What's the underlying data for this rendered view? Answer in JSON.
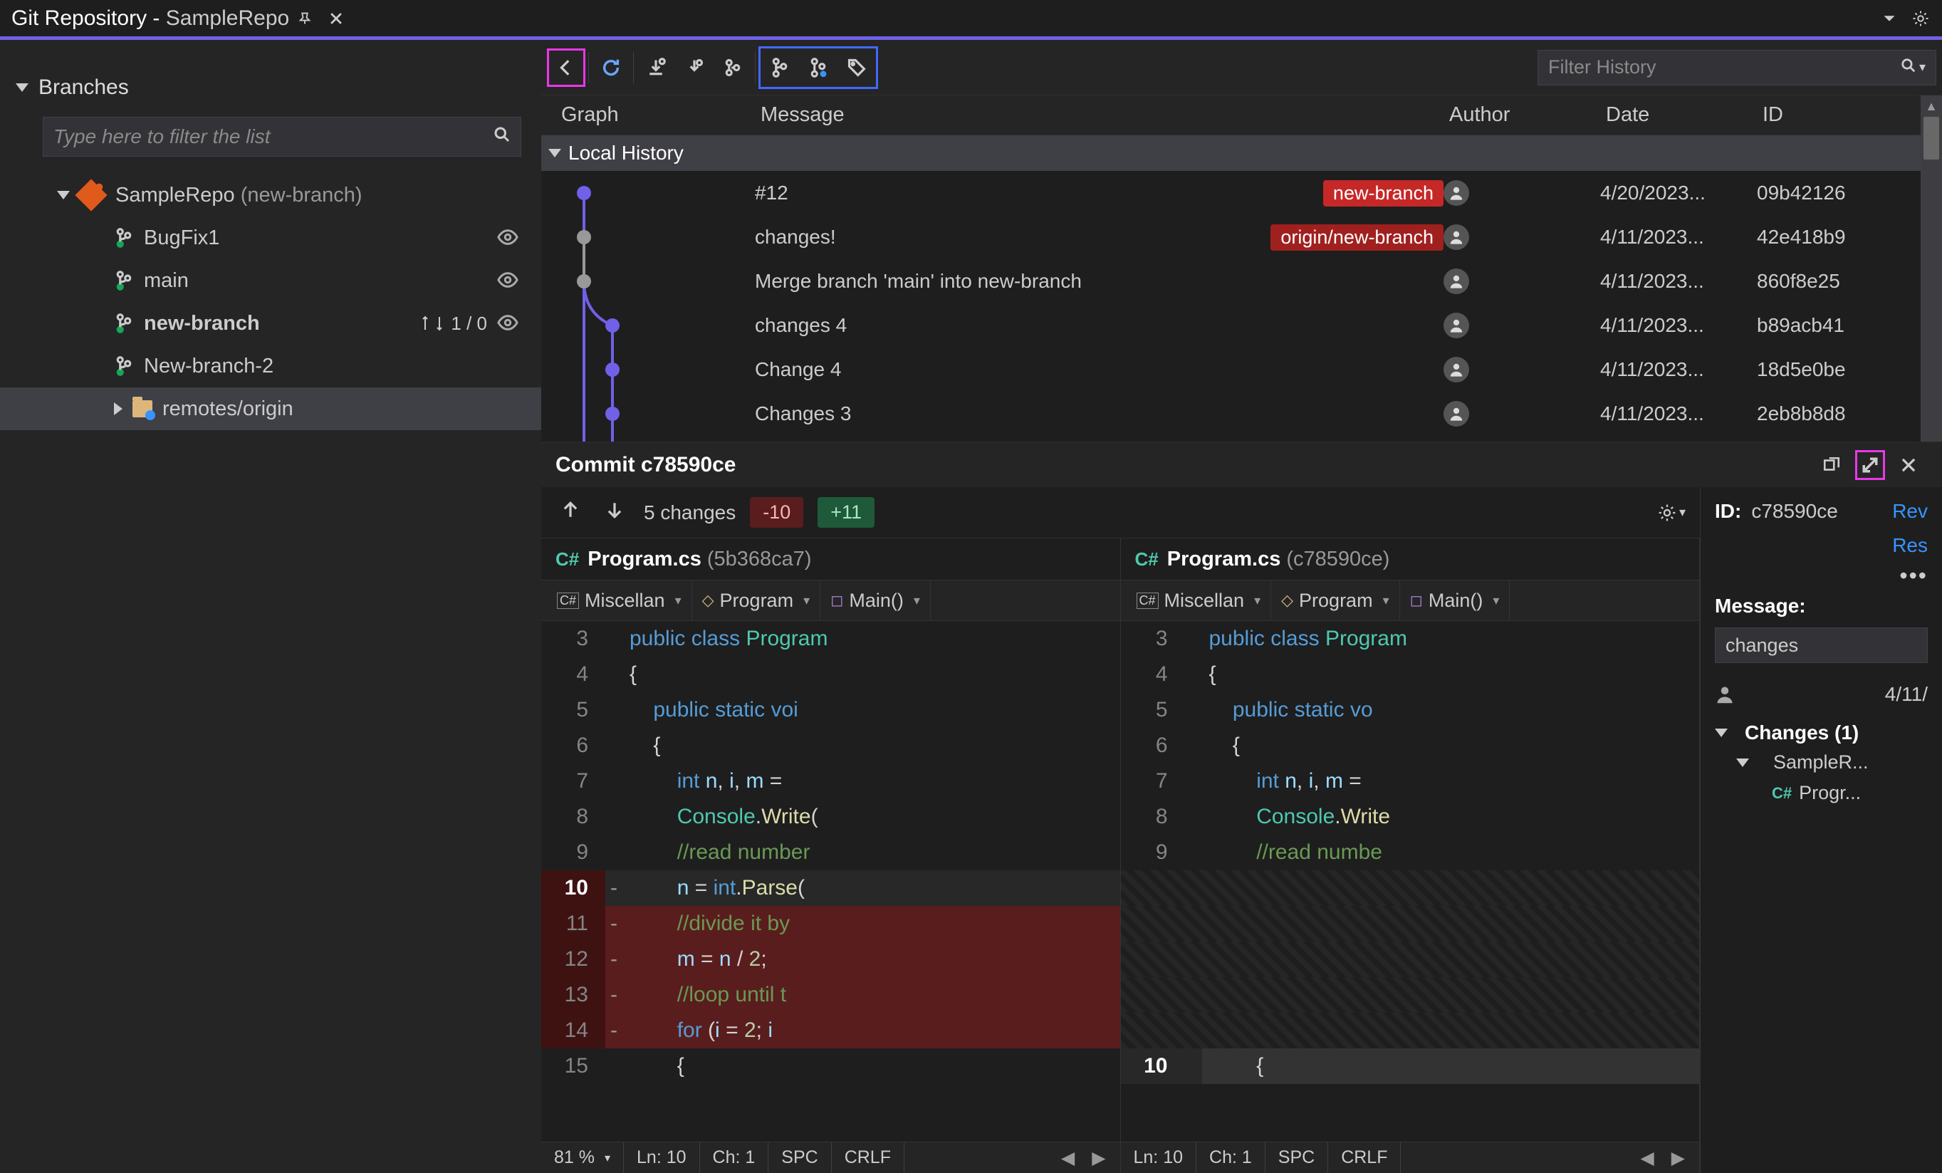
{
  "title": {
    "app": "Git Repository",
    "repo": "SampleRepo"
  },
  "sidebar": {
    "branches_label": "Branches",
    "filter_placeholder": "Type here to filter the list",
    "repo_name": "SampleRepo",
    "repo_current": "(new-branch)",
    "branches": [
      {
        "name": "BugFix1",
        "bold": false,
        "ahead_behind": "",
        "eye": true
      },
      {
        "name": "main",
        "bold": false,
        "ahead_behind": "",
        "eye": true
      },
      {
        "name": "new-branch",
        "bold": true,
        "ahead_behind": "1 / 0",
        "eye": true
      },
      {
        "name": "New-branch-2",
        "bold": false,
        "ahead_behind": "",
        "eye": false
      }
    ],
    "remotes_label": "remotes/origin"
  },
  "toolbar": {
    "filter_history_placeholder": "Filter History"
  },
  "history": {
    "cols": {
      "graph": "Graph",
      "message": "Message",
      "author": "Author",
      "date": "Date",
      "id": "ID"
    },
    "local_label": "Local History",
    "rows": [
      {
        "msg": "#12",
        "badge": "new-branch",
        "badge_class": "red",
        "date": "4/20/2023...",
        "id": "09b42126"
      },
      {
        "msg": "changes!",
        "badge": "origin/new-branch",
        "badge_class": "darkred",
        "date": "4/11/2023...",
        "id": "42e418b9"
      },
      {
        "msg": "Merge branch 'main' into new-branch",
        "badge": "",
        "badge_class": "",
        "date": "4/11/2023...",
        "id": "860f8e25"
      },
      {
        "msg": "changes 4",
        "badge": "",
        "badge_class": "",
        "date": "4/11/2023...",
        "id": "b89acb41"
      },
      {
        "msg": "Change 4",
        "badge": "",
        "badge_class": "",
        "date": "4/11/2023...",
        "id": "18d5e0be"
      },
      {
        "msg": "Changes 3",
        "badge": "",
        "badge_class": "",
        "date": "4/11/2023...",
        "id": "2eb8b8d8"
      }
    ]
  },
  "commit": {
    "title": "Commit c78590ce",
    "changes_label": "5 changes",
    "minus": "-10",
    "plus": "+11",
    "left": {
      "file": "Program.cs",
      "hash": "(5b368ca7)"
    },
    "right": {
      "file": "Program.cs",
      "hash": "(c78590ce)"
    },
    "crumbs": {
      "proj": "Miscellan",
      "ns": "Program",
      "method": "Main()"
    },
    "status": {
      "zoom": "81 %",
      "ln": "Ln: 10",
      "ch": "Ch: 1",
      "spc": "SPC",
      "crlf": "CRLF"
    }
  },
  "details": {
    "id_label": "ID:",
    "id_val": "c78590ce",
    "rev": "Rev",
    "res": "Res",
    "message_label": "Message:",
    "message_val": "changes",
    "date": "4/11/",
    "changes_label": "Changes (1)",
    "folder": "SampleR...",
    "file": "Progr..."
  }
}
